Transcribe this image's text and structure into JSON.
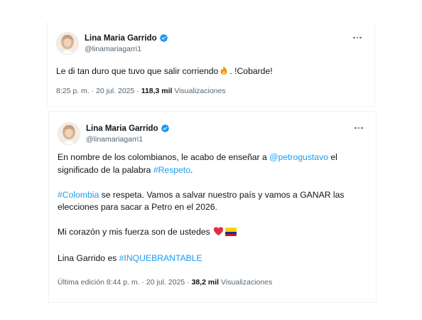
{
  "tweets": [
    {
      "author": {
        "display_name": "Lina Maria Garrido",
        "handle": "@linamariagarri1",
        "avatar_icon": "profile-photo-avatar",
        "verified_icon": "verified-badge-icon",
        "verified_color": "#1d9bf0"
      },
      "more_icon": "more-options-icon",
      "text": {
        "before_emoji": "Le di tan duro que tuvo que salir corriendo",
        "emoji": "fire-emoji",
        "after_emoji": ". !Cobarde!"
      },
      "meta": {
        "time": "8:25 p. m.",
        "separator": "·",
        "date": "20 jul. 2025",
        "separator2": "·",
        "views_count": "118,3 mil",
        "views_label": "Visualizaciones"
      }
    },
    {
      "author": {
        "display_name": "Lina Maria Garrido",
        "handle": "@linamariagarri1",
        "avatar_icon": "profile-photo-avatar",
        "verified_icon": "verified-badge-icon",
        "verified_color": "#1d9bf0"
      },
      "more_icon": "more-options-icon",
      "paragraph1": {
        "before_mention": "En nombre de los colombianos, le acabo de enseñar a ",
        "mention": "@petrogustavo",
        "after_mention": " el significado de la palabra ",
        "hashtag": "#Respeto",
        "end": "."
      },
      "paragraph2": {
        "hashtag": "#Colombia",
        "text": " se respeta. Vamos a salvar nuestro país y vamos a GANAR las elecciones para sacar a Petro en el 2026."
      },
      "paragraph3": {
        "text": "Mi corazón y mis fuerza son de ustedes ",
        "emoji1": "red-heart-emoji",
        "emoji2": "colombia-flag-emoji"
      },
      "paragraph4": {
        "text": "Lina Garrido es ",
        "hashtag": "#INQUEBRANTABLE"
      },
      "meta": {
        "edited": "Última edición",
        "time": "8:44 p. m.",
        "separator": "·",
        "date": "20 jul. 2025",
        "separator2": "·",
        "views_count": "38,2 mil",
        "views_label": "Visualizaciones"
      }
    }
  ],
  "colors": {
    "link": "#1d9bf0",
    "text_primary": "#0f1419",
    "text_secondary": "#536471",
    "border": "#eff3f4"
  }
}
